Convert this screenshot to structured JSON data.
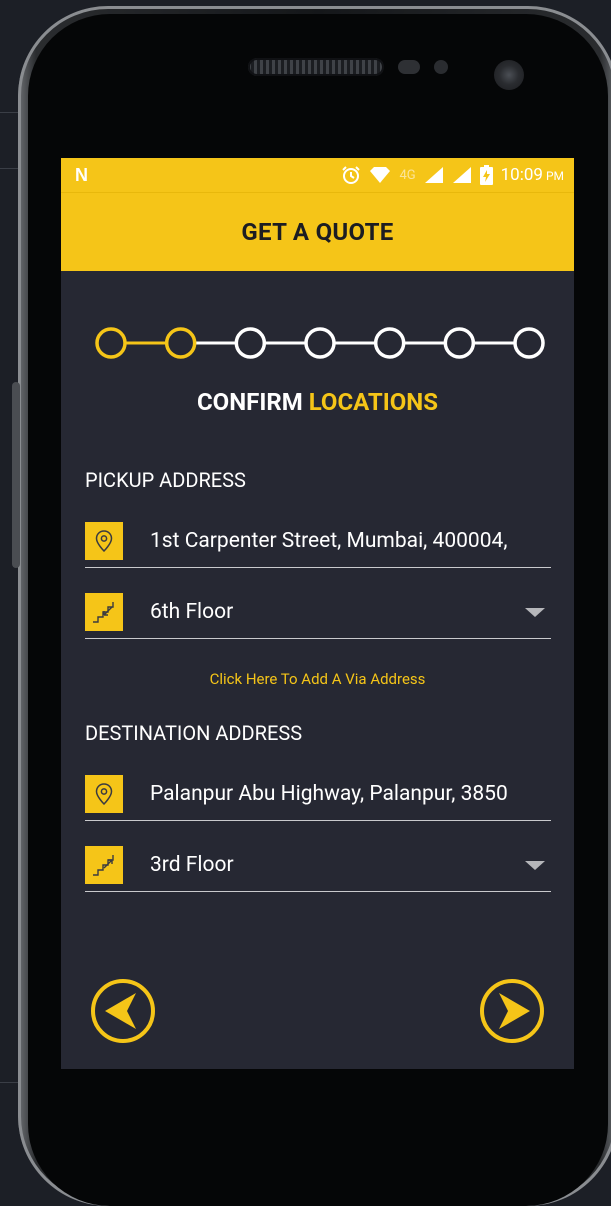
{
  "status_bar": {
    "time": "10:09",
    "ampm": "PM",
    "network": "4G"
  },
  "app_bar": {
    "title": "GET A QUOTE"
  },
  "stepper": {
    "total_steps": 7,
    "completed_steps": 2,
    "active_color": "#f5c518",
    "inactive_color": "#ffffff"
  },
  "step_title": {
    "prefix": "CONFIRM",
    "highlight": "LOCATIONS"
  },
  "pickup": {
    "label": "PICKUP ADDRESS",
    "address": "1st Carpenter Street, Mumbai, 400004,",
    "floor": "6th Floor"
  },
  "via_link": "Click Here To Add A Via Address",
  "destination": {
    "label": "DESTINATION ADDRESS",
    "address": "Palanpur Abu Highway, Palanpur, 3850",
    "floor": "3rd Floor"
  },
  "icons": {
    "location": "location-pin-icon",
    "stairs_down": "stairs-down-icon",
    "stairs_up": "stairs-up-icon",
    "back": "back-arrow-icon",
    "next": "next-arrow-icon"
  },
  "colors": {
    "accent": "#f5c518",
    "screen_bg": "#262833"
  }
}
